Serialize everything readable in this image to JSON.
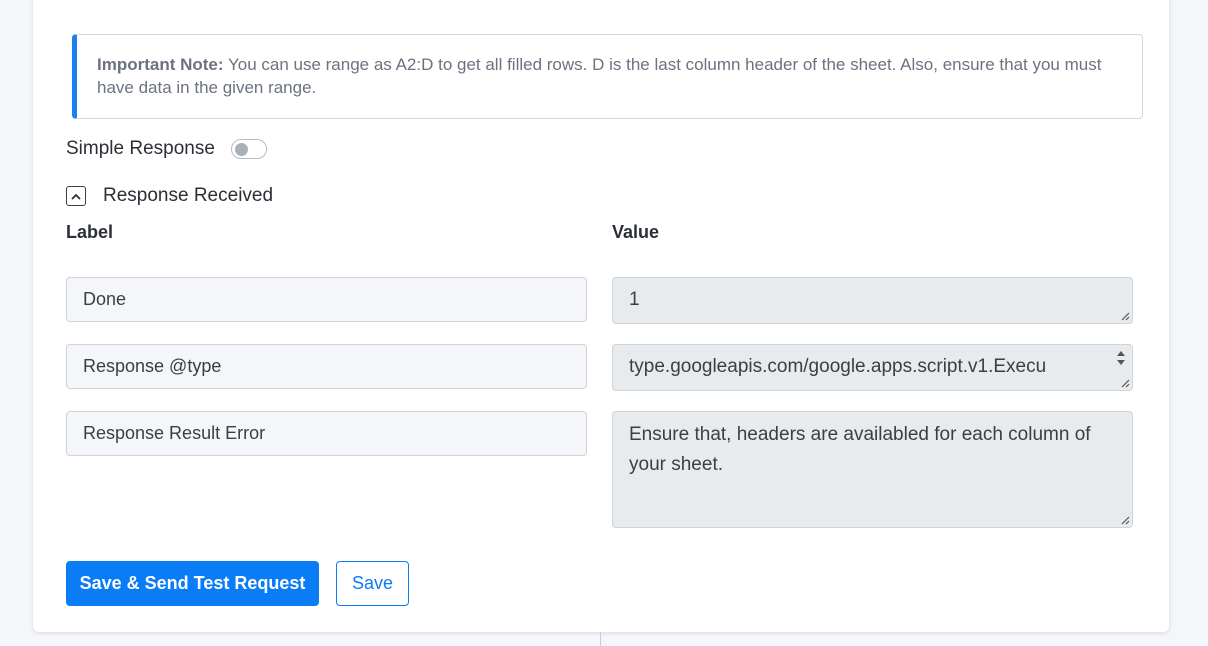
{
  "note": {
    "title": "Important Note:",
    "text": " You can use range as A2:D to get all filled rows. D is the last column header of the sheet. Also, ensure that you must have data in the given range."
  },
  "simple_response": {
    "label": "Simple Response",
    "enabled": false
  },
  "response_section": {
    "label": "Response Received",
    "expanded": true
  },
  "columns": {
    "label": "Label",
    "value": "Value"
  },
  "rows": [
    {
      "label": "Done",
      "value": "1"
    },
    {
      "label": "Response @type",
      "value": "type.googleapis.com/google.apps.script.v1.Execu"
    },
    {
      "label": "Response Result Error",
      "value": "Ensure that, headers are availabled for each column of your sheet."
    }
  ],
  "buttons": {
    "save_send": "Save & Send Test Request",
    "save": "Save"
  },
  "colors": {
    "accent": "#0a7cf5",
    "note_border": "#1a7ff0"
  }
}
